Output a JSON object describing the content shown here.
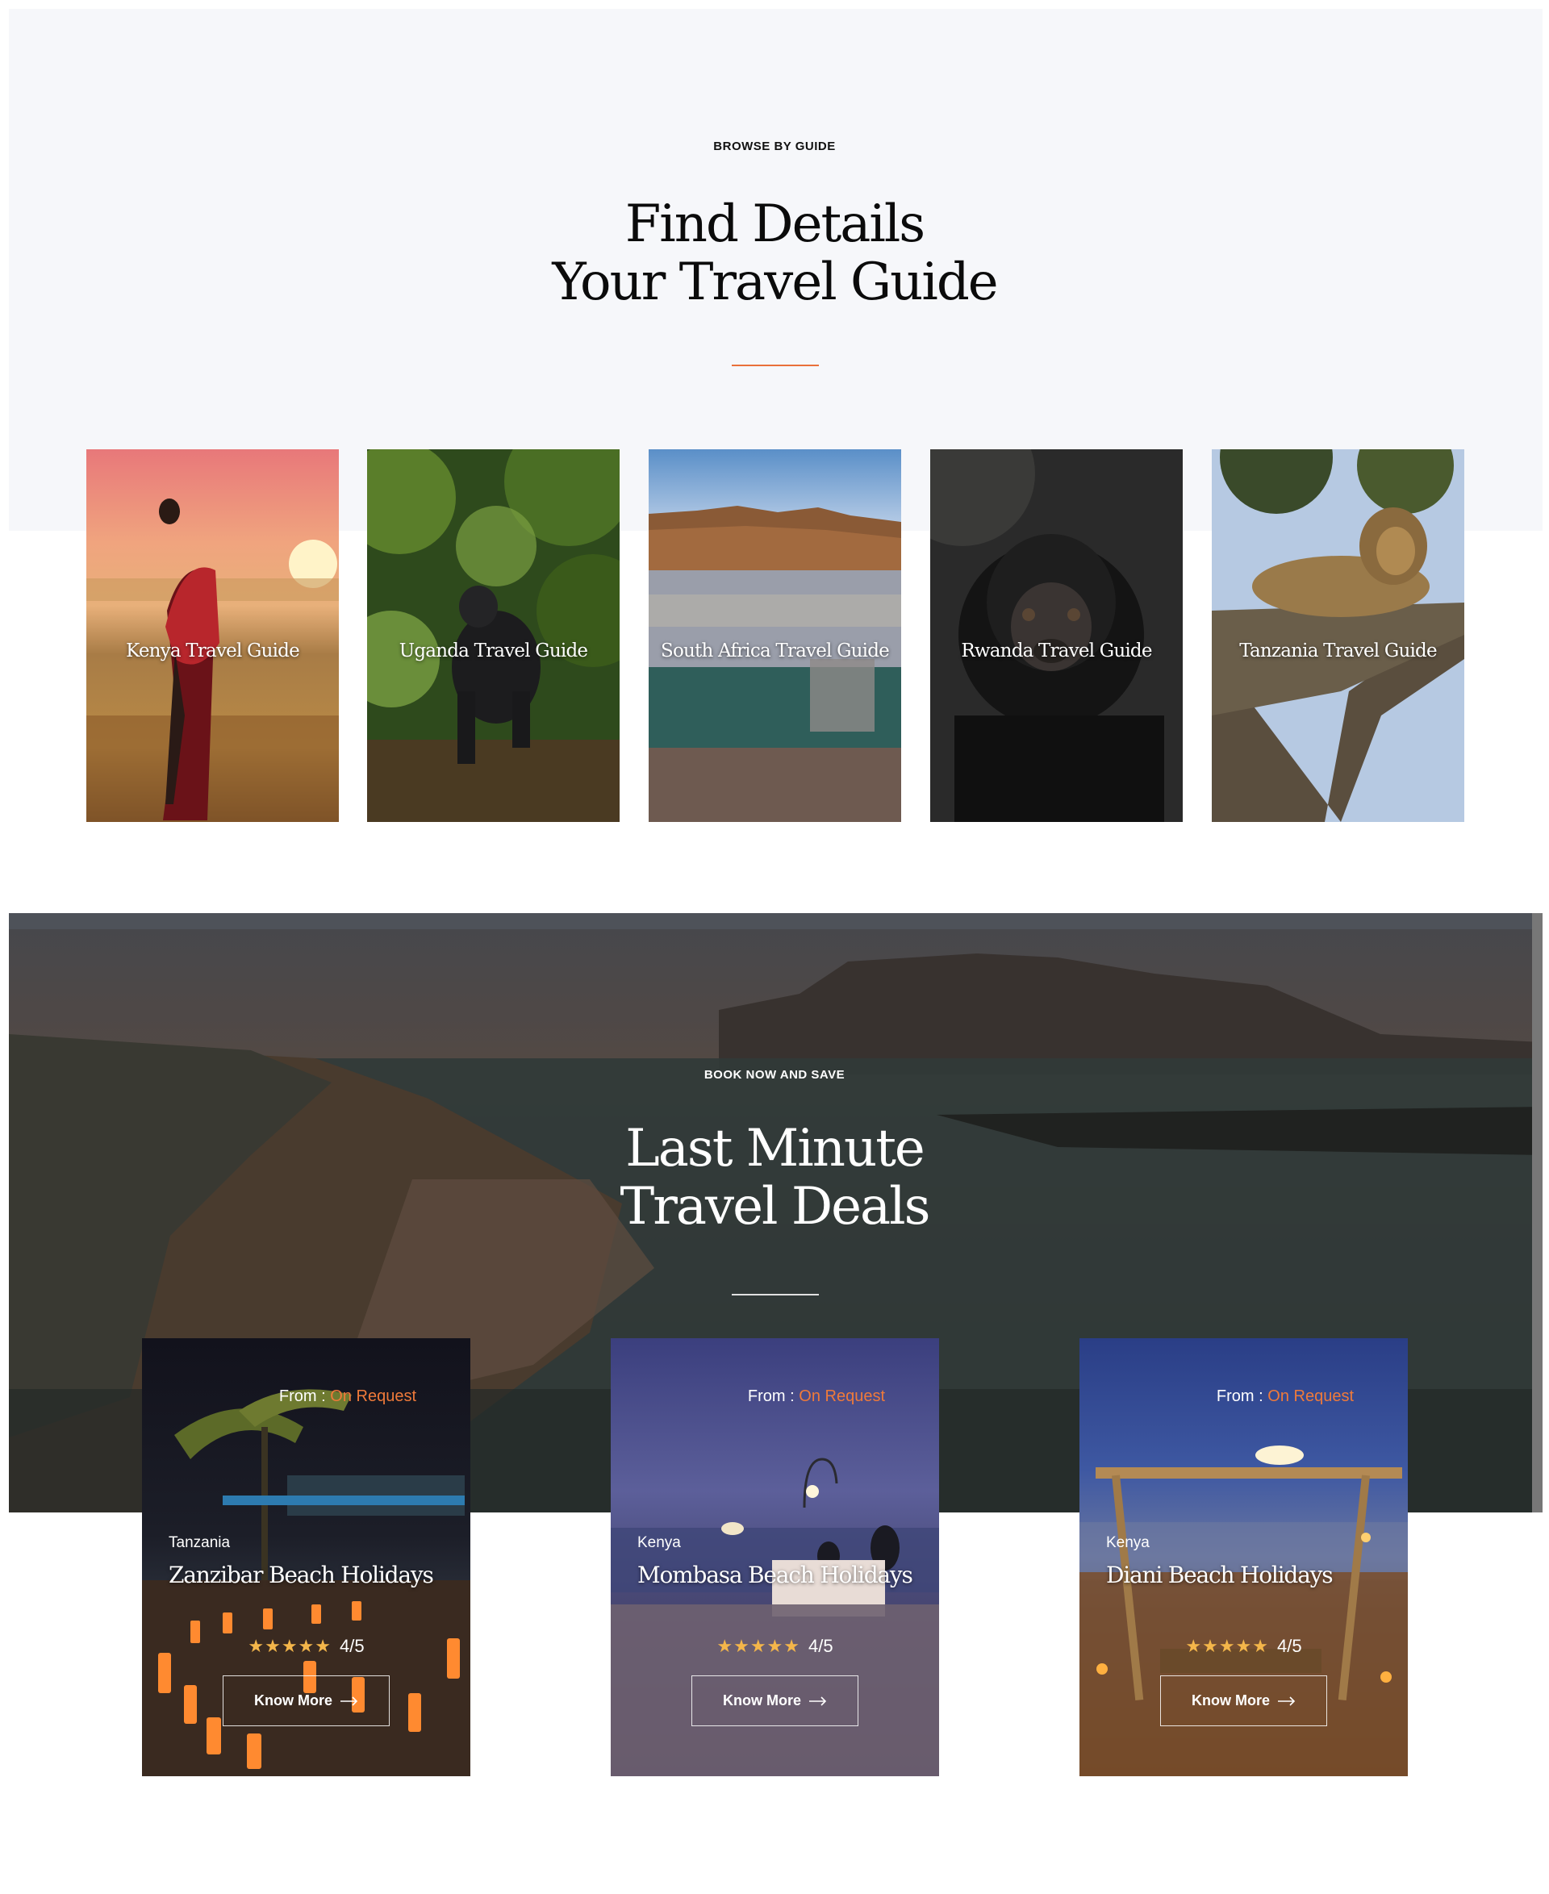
{
  "guides_section": {
    "eyebrow": "BROWSE BY GUIDE",
    "headline_line1": "Find Details",
    "headline_line2": "Your Travel Guide",
    "accent_color": "#e9703a",
    "guides": [
      {
        "label": "Kenya Travel Guide"
      },
      {
        "label": "Uganda Travel Guide"
      },
      {
        "label": "South Africa Travel Guide"
      },
      {
        "label": "Rwanda Travel Guide"
      },
      {
        "label": "Tanzania Travel Guide"
      }
    ]
  },
  "deals_section": {
    "eyebrow": "BOOK NOW AND SAVE",
    "headline_line1": "Last Minute",
    "headline_line2": "Travel Deals",
    "deals": [
      {
        "price_prefix": "From : ",
        "price_value": "On Request",
        "country": "Tanzania",
        "title": "Zanzibar Beach Holidays",
        "stars": "★★★★★",
        "rating": "4/5",
        "button_label": "Know More"
      },
      {
        "price_prefix": "From : ",
        "price_value": "On Request",
        "country": "Kenya",
        "title": "Mombasa Beach Holidays",
        "stars": "★★★★★",
        "rating": "4/5",
        "button_label": "Know More"
      },
      {
        "price_prefix": "From : ",
        "price_value": "On Request",
        "country": "Kenya",
        "title": "Diani Beach Holidays",
        "stars": "★★★★★",
        "rating": "4/5",
        "button_label": "Know More"
      }
    ],
    "price_accent_color": "#ef7a3a",
    "star_color": "#f4b64a"
  }
}
